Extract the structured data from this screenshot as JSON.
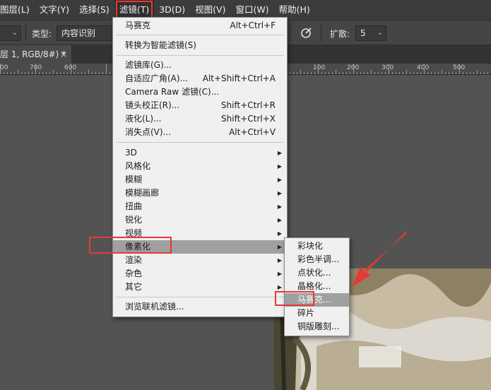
{
  "menubar": {
    "items": [
      "图层(L)",
      "文字(Y)",
      "选择(S)",
      "滤镜(T)",
      "3D(D)",
      "视图(V)",
      "窗口(W)",
      "帮助(H)"
    ],
    "active_index": 3
  },
  "options_bar": {
    "type_label": "类型:",
    "type_value": "内容识别",
    "spread_label": "扩散:",
    "spread_value": "5"
  },
  "document_tab": {
    "title": "层 1, RGB/8#) *",
    "close": "×"
  },
  "ruler": {
    "labels": [
      "00",
      "700",
      "600",
      "100",
      "200",
      "300",
      "400",
      "500"
    ]
  },
  "filter_menu": {
    "items": [
      {
        "label": "马赛克",
        "shortcut": "Alt+Ctrl+F"
      },
      {
        "label": "转换为智能滤镜(S)"
      },
      {
        "label": "滤镜库(G)..."
      },
      {
        "label": "自适应广角(A)...",
        "shortcut": "Alt+Shift+Ctrl+A"
      },
      {
        "label": "Camera Raw 滤镜(C)...",
        "shortcut": "Shift+Ctrl+A"
      },
      {
        "label": "镜头校正(R)...",
        "shortcut": "Shift+Ctrl+R"
      },
      {
        "label": "液化(L)...",
        "shortcut": "Shift+Ctrl+X"
      },
      {
        "label": "消失点(V)...",
        "shortcut": "Alt+Ctrl+V"
      },
      {
        "label": "3D",
        "submenu": true
      },
      {
        "label": "风格化",
        "submenu": true
      },
      {
        "label": "模糊",
        "submenu": true
      },
      {
        "label": "模糊画廊",
        "submenu": true
      },
      {
        "label": "扭曲",
        "submenu": true
      },
      {
        "label": "锐化",
        "submenu": true
      },
      {
        "label": "视频",
        "submenu": true
      },
      {
        "label": "像素化",
        "submenu": true,
        "highlighted": true
      },
      {
        "label": "渲染",
        "submenu": true
      },
      {
        "label": "杂色",
        "submenu": true
      },
      {
        "label": "其它",
        "submenu": true
      },
      {
        "label": "浏览联机滤镜..."
      }
    ]
  },
  "pixelate_submenu": {
    "items": [
      "彩块化",
      "彩色半调...",
      "点状化...",
      "晶格化...",
      "马赛克...",
      "碎片",
      "铜版雕刻..."
    ],
    "highlighted_index": 4
  },
  "colors": {
    "annotation_red": "#e53935",
    "menu_bg": "#f0f0f0",
    "menu_highlight": "#a0a0a0"
  }
}
